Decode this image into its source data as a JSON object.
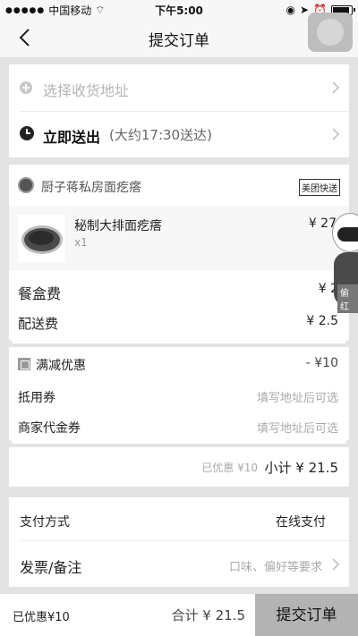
{
  "status_bar": {
    "carrier": "中国移动",
    "time": "下午5:00"
  },
  "nav": {
    "title": "提交订单"
  },
  "address": {
    "placeholder": "选择收货地址"
  },
  "delivery_time": {
    "label": "立即送出",
    "eta": "(大约17:30送达)"
  },
  "shop": {
    "name": "厨子蒋私房面疙瘩",
    "badge": "美团快送"
  },
  "item": {
    "name": "秘制大排面疙瘩",
    "qty": "x1",
    "price": "¥ 27"
  },
  "fees": {
    "box_label": "餐盒费",
    "box_value": "¥ 2",
    "delivery_label": "配送费",
    "delivery_value": "¥ 2.5"
  },
  "discounts": {
    "promo_label": "满减优惠",
    "promo_value": "- ¥10",
    "coupon_label": "抵用券",
    "coupon_hint": "填写地址后可选",
    "voucher_label": "商家代金券",
    "voucher_hint": "填写地址后可选"
  },
  "subtotal": {
    "saved": "已优惠 ¥10",
    "total": "小计 ¥ 21.5"
  },
  "payment": {
    "label": "支付方式",
    "value": "在线支付"
  },
  "invoice": {
    "label": "发票/备注",
    "hint": "口味、偏好等要求"
  },
  "bottom_bar": {
    "saved": "已优惠¥10",
    "total": "合计 ¥ 21.5",
    "submit": "提交订单"
  },
  "mascot": {
    "tag": "偷红"
  }
}
